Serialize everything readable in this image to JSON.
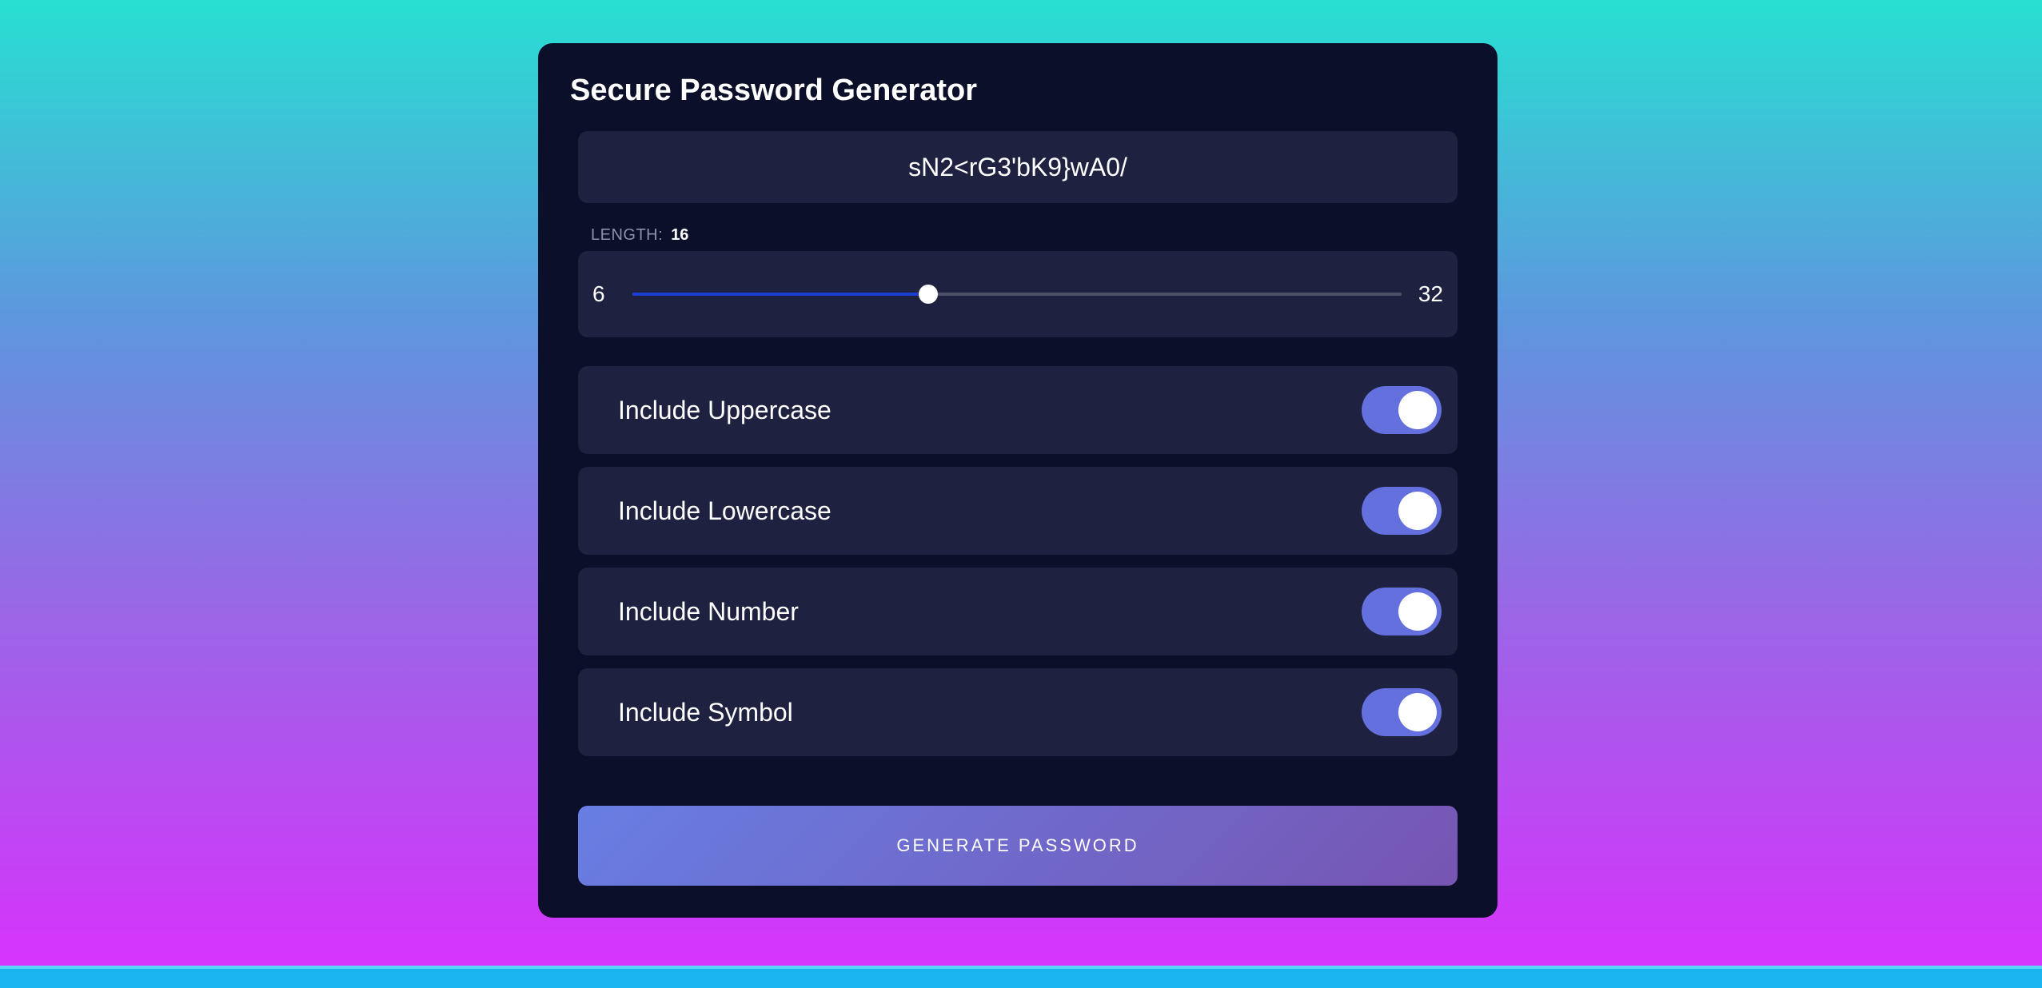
{
  "title": "Secure Password Generator",
  "password": "sN2<rG3'bK9}wA0/",
  "length": {
    "label": "LENGTH:",
    "value": "16",
    "min": "6",
    "max": "32",
    "fraction": 0.3846
  },
  "options": [
    {
      "label": "Include Uppercase",
      "checked": true
    },
    {
      "label": "Include Lowercase",
      "checked": true
    },
    {
      "label": "Include Number",
      "checked": true
    },
    {
      "label": "Include Symbol",
      "checked": true
    }
  ],
  "generate_label": "Generate Password",
  "colors": {
    "card": "#0b0f2a",
    "panel": "#1e213f",
    "toggle_on": "#6570df",
    "slider_fill": "#1b3fd1"
  }
}
